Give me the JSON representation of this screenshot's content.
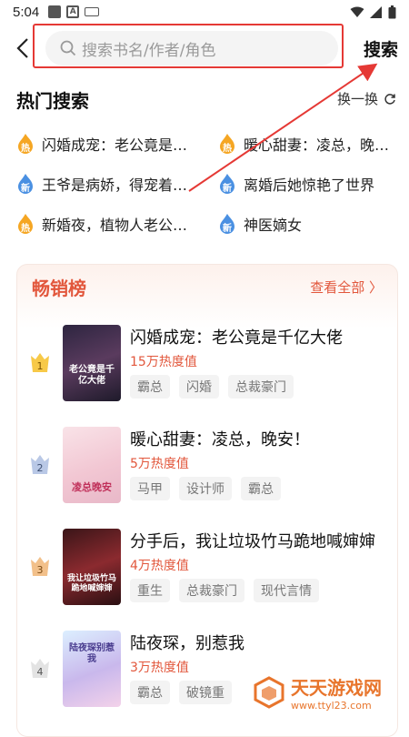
{
  "status": {
    "time": "5:04",
    "a_label": "A"
  },
  "search": {
    "placeholder": "搜索书名/作者/角色",
    "button": "搜索"
  },
  "hot": {
    "title": "热门搜索",
    "refresh": "换一换",
    "items": [
      {
        "badge": "热",
        "type": "hot",
        "text": "闪婚成宠：老公竟是…"
      },
      {
        "badge": "热",
        "type": "hot",
        "text": "暖心甜妻：凌总，晚…"
      },
      {
        "badge": "新",
        "type": "new",
        "text": "王爷是病娇，得宠着…"
      },
      {
        "badge": "新",
        "type": "new",
        "text": "离婚后她惊艳了世界"
      },
      {
        "badge": "热",
        "type": "hot",
        "text": "新婚夜，植物人老公…"
      },
      {
        "badge": "新",
        "type": "new",
        "text": "神医嫡女"
      }
    ]
  },
  "bestseller": {
    "title": "畅销榜",
    "view_all": "查看全部 〉",
    "books": [
      {
        "rank": "1",
        "title": "闪婚成宠：老公竟是千亿大佬",
        "heat": "15万热度值",
        "tags": [
          "霸总",
          "闪婚",
          "总裁豪门"
        ],
        "cover_text": "老公竟是千亿大佬"
      },
      {
        "rank": "2",
        "title": "暖心甜妻：凌总，晚安！",
        "heat": "5万热度值",
        "tags": [
          "马甲",
          "设计师",
          "霸总"
        ],
        "cover_text": "凌总晚安"
      },
      {
        "rank": "3",
        "title": "分手后，我让垃圾竹马跪地喊婶婶",
        "heat": "4万热度值",
        "tags": [
          "重生",
          "总裁豪门",
          "现代言情"
        ],
        "cover_text": "我让垃圾竹马跪地喊婶婶"
      },
      {
        "rank": "4",
        "title": "陆夜琛，别惹我",
        "heat": "3万热度值",
        "tags": [
          "霸总",
          "破镜重"
        ],
        "cover_text": "陆夜琛别惹我"
      }
    ]
  },
  "watermark": {
    "name": "天天游戏网",
    "url": "www.ttyl23.com"
  },
  "colors": {
    "accent": "#e2573c",
    "hot_badge": "#f5a623",
    "new_badge": "#4a90e2",
    "highlight": "#e53935"
  }
}
